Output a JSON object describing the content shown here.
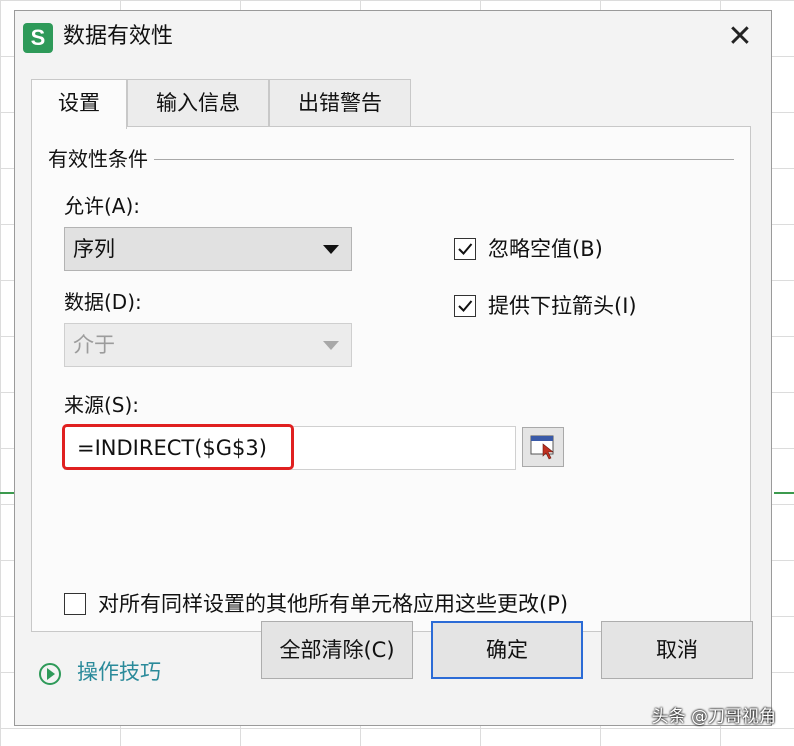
{
  "app": {
    "icon_letter": "S",
    "title": "数据有效性"
  },
  "tabs": [
    {
      "label": "设置",
      "active": true
    },
    {
      "label": "输入信息",
      "active": false
    },
    {
      "label": "出错警告",
      "active": false
    }
  ],
  "settings": {
    "group_title": "有效性条件",
    "allow": {
      "label": "允许(A):",
      "value": "序列"
    },
    "data": {
      "label": "数据(D):",
      "value": "介于",
      "disabled": true
    },
    "ignore_blank": {
      "label": "忽略空值(B)",
      "checked": true
    },
    "dropdown_arrow": {
      "label": "提供下拉箭头(I)",
      "checked": true
    },
    "source": {
      "label": "来源(S):",
      "value": "=INDIRECT($G$3)"
    },
    "apply_all": {
      "label": "对所有同样设置的其他所有单元格应用这些更改(P)",
      "checked": false
    }
  },
  "footer": {
    "tips_label": "操作技巧",
    "clear_all": "全部清除(C)",
    "ok": "确定",
    "cancel": "取消"
  },
  "watermark": "头条 @刀哥视角",
  "colors": {
    "highlight": "#e02020",
    "brand_green": "#2e9a59",
    "primary_border": "#2b6bd6"
  }
}
